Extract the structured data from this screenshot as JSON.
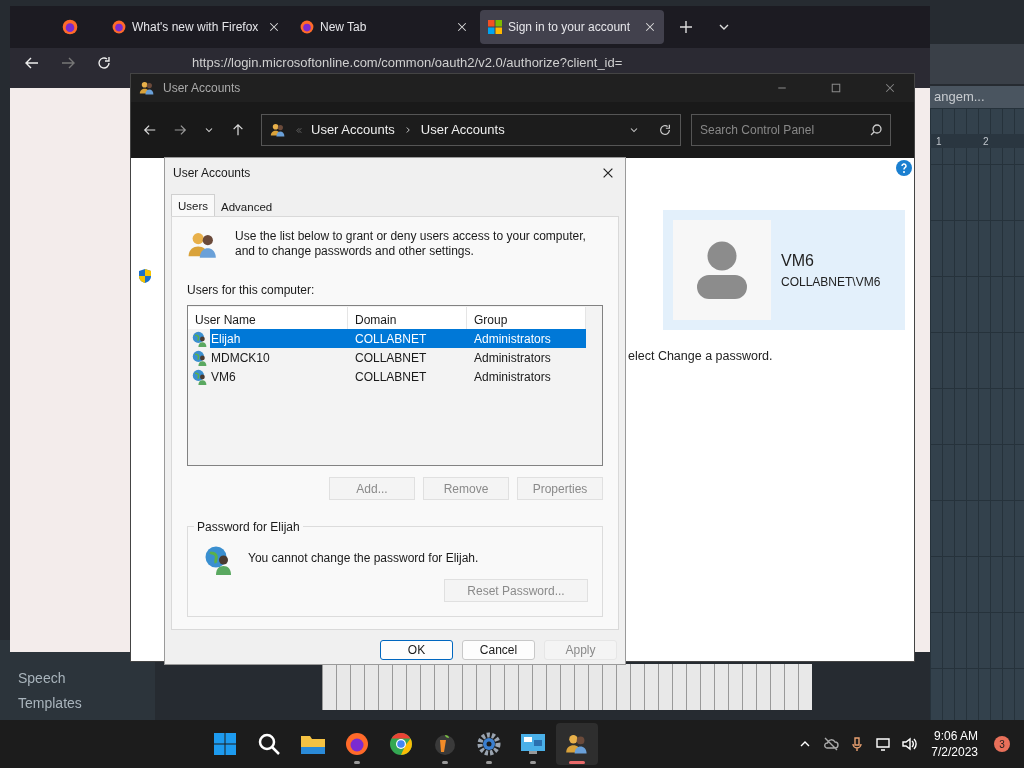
{
  "browser": {
    "tabs": [
      {
        "title": "What's new with Firefox",
        "selected": false
      },
      {
        "title": "New Tab",
        "selected": false
      },
      {
        "title": "Sign in to your account",
        "selected": true
      }
    ],
    "url": "https://login.microsoftonline.com/common/oauth2/v2.0/authorize?client_id="
  },
  "control_panel": {
    "title": "User Accounts",
    "breadcrumb": [
      "User Accounts",
      "User Accounts"
    ],
    "search": {
      "placeholder": "Search Control Panel"
    },
    "user_card": {
      "name": "VM6",
      "account": "COLLABNET\\VM6"
    },
    "hint": "elect Change a password."
  },
  "dialog": {
    "title": "User Accounts",
    "tabs": [
      {
        "label": "Users",
        "selected": true
      },
      {
        "label": "Advanced",
        "selected": false
      }
    ],
    "intro": "Use the list below to grant or deny users access to your computer, and to change passwords and other settings.",
    "list_label": "Users for this computer:",
    "columns": [
      "User Name",
      "Domain",
      "Group"
    ],
    "rows": [
      {
        "user": "Elijah",
        "domain": "COLLABNET",
        "group": "Administrators",
        "selected": true
      },
      {
        "user": "MDMCK10",
        "domain": "COLLABNET",
        "group": "Administrators",
        "selected": false
      },
      {
        "user": "VM6",
        "domain": "COLLABNET",
        "group": "Administrators",
        "selected": false
      }
    ],
    "list_buttons": [
      {
        "label": "Add...",
        "disabled": true
      },
      {
        "label": "Remove",
        "disabled": true
      },
      {
        "label": "Properties",
        "disabled": true
      }
    ],
    "password_group": {
      "title": "Password for Elijah",
      "message": "You cannot change the password for Elijah.",
      "button": {
        "label": "Reset Password...",
        "disabled": true
      }
    },
    "buttons": [
      {
        "label": "OK",
        "disabled": false
      },
      {
        "label": "Cancel",
        "disabled": false
      },
      {
        "label": "Apply",
        "disabled": true
      }
    ]
  },
  "background_app": {
    "panel_title": "angem...",
    "ruler": [
      "1",
      "2"
    ],
    "browser_items": [
      "Speech",
      "Templates"
    ]
  },
  "taskbar": {
    "apps": [
      {
        "kind": "start",
        "running": false,
        "active": false
      },
      {
        "kind": "search",
        "running": false,
        "active": false
      },
      {
        "kind": "explorer",
        "running": false,
        "active": false
      },
      {
        "kind": "firefox",
        "running": true,
        "active": false
      },
      {
        "kind": "chrome",
        "running": false,
        "active": false
      },
      {
        "kind": "fruit",
        "running": true,
        "active": false
      },
      {
        "kind": "settings",
        "running": true,
        "active": false
      },
      {
        "kind": "control",
        "running": true,
        "active": false
      },
      {
        "kind": "users",
        "running": true,
        "active": true
      }
    ],
    "time": "9:06 AM",
    "date": "7/2/2023",
    "notifications": "3"
  }
}
